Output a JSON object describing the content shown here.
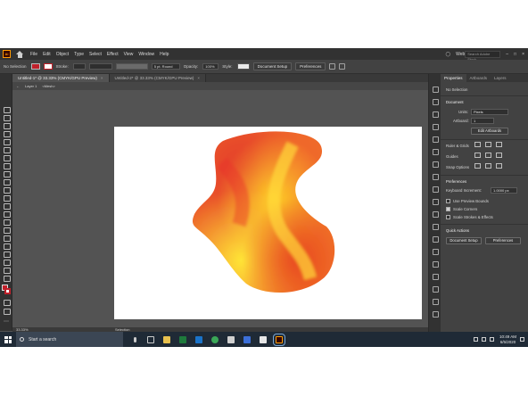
{
  "menubar": {
    "app_logo": "Ai",
    "items": [
      "File",
      "Edit",
      "Object",
      "Type",
      "Select",
      "Effect",
      "View",
      "Window",
      "Help"
    ],
    "workspace": "Web",
    "stock_search_placeholder": "Search Adobe Stock"
  },
  "controlbar": {
    "selection": "No Selection",
    "fill_color": "#c0202a",
    "stroke_label": "Stroke:",
    "brush": "5 pt. Round",
    "opacity_label": "Opacity:",
    "opacity_value": "100%",
    "style_label": "Style:",
    "document_setup": "Document Setup",
    "preferences": "Preferences"
  },
  "tabs": [
    {
      "label": "Untitled-1* @ 33.33% (CMYK/GPU Preview)",
      "active": true
    },
    {
      "label": "Untitled-2* @ 33.33% (CMYK/GPU Preview)",
      "active": false
    }
  ],
  "breadcrumb": {
    "layer": "Layer 1",
    "object": "<Mesh>"
  },
  "status": {
    "zoom": "33.33%",
    "tool": "Selection"
  },
  "panel": {
    "tabs": [
      "Properties",
      "Artboards",
      "Layers"
    ],
    "no_selection": "No Selection",
    "document": "Document",
    "units_label": "Units:",
    "units_value": "Pixels",
    "artboard_label": "Artboard:",
    "artboard_value": "1",
    "edit_artboards": "Edit Artboards",
    "ruler_grids": "Ruler & Grids",
    "guides": "Guides",
    "snap_options": "Snap Options",
    "preferences": "Preferences",
    "keyboard_increment_label": "Keyboard Increment:",
    "keyboard_increment_value": "1.0000 px",
    "use_preview_bounds": "Use Preview Bounds",
    "scale_corners": "Scale Corners",
    "scale_strokes": "Scale Strokes & Effects",
    "quick_actions": "Quick Actions",
    "document_setup": "Document Setup",
    "preferences_button": "Preferences"
  },
  "taskbar": {
    "search_placeholder": "Start a search",
    "time": "10:49 AM",
    "date": "6/5/2020"
  },
  "colors": {
    "fill_swatch": "#c0202a",
    "accent": "#ff9a00"
  }
}
